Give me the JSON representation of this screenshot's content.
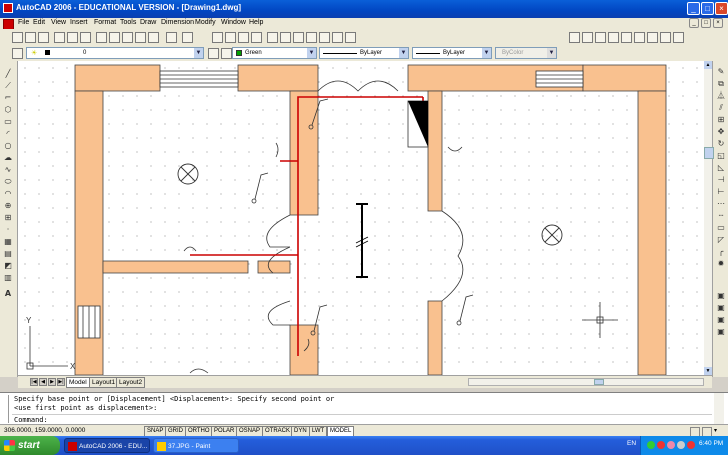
{
  "window": {
    "title": "AutoCAD 2006 - EDUCATIONAL VERSION - [Drawing1.dwg]"
  },
  "menu": [
    "File",
    "Edit",
    "View",
    "Insert",
    "Format",
    "Tools",
    "Draw",
    "Dimension",
    "Modify",
    "Window",
    "Help"
  ],
  "properties_toolbar": {
    "layer": "0",
    "color": "Green",
    "linetype": "ByLayer",
    "lineweight": "ByLayer",
    "plotstyle": "ByColor",
    "color_hex": "#00a000"
  },
  "drawing": {
    "wall_color": "#f9c18f",
    "wire_color": "#cc0000",
    "ucs_x": "X",
    "ucs_y": "Y"
  },
  "tabs": [
    "Model",
    "Layout1",
    "Layout2"
  ],
  "command": {
    "line1": "Specify base point or [Displacement] <Displacement>: Specify second point or",
    "line2": "<use first point as displacement>:",
    "prompt": "Command:"
  },
  "status": {
    "coords": "306.0000, 159.0000, 0.0000",
    "buttons": [
      "SNAP",
      "GRID",
      "ORTHO",
      "POLAR",
      "OSNAP",
      "OTRACK",
      "DYN",
      "LWT",
      "MODEL"
    ]
  },
  "taskbar": {
    "start_label": "start",
    "tasks": [
      "AutoCAD 2006 - EDU...",
      "37.JPG - Paint"
    ],
    "lang": "EN",
    "clock": "6:40 PM"
  }
}
